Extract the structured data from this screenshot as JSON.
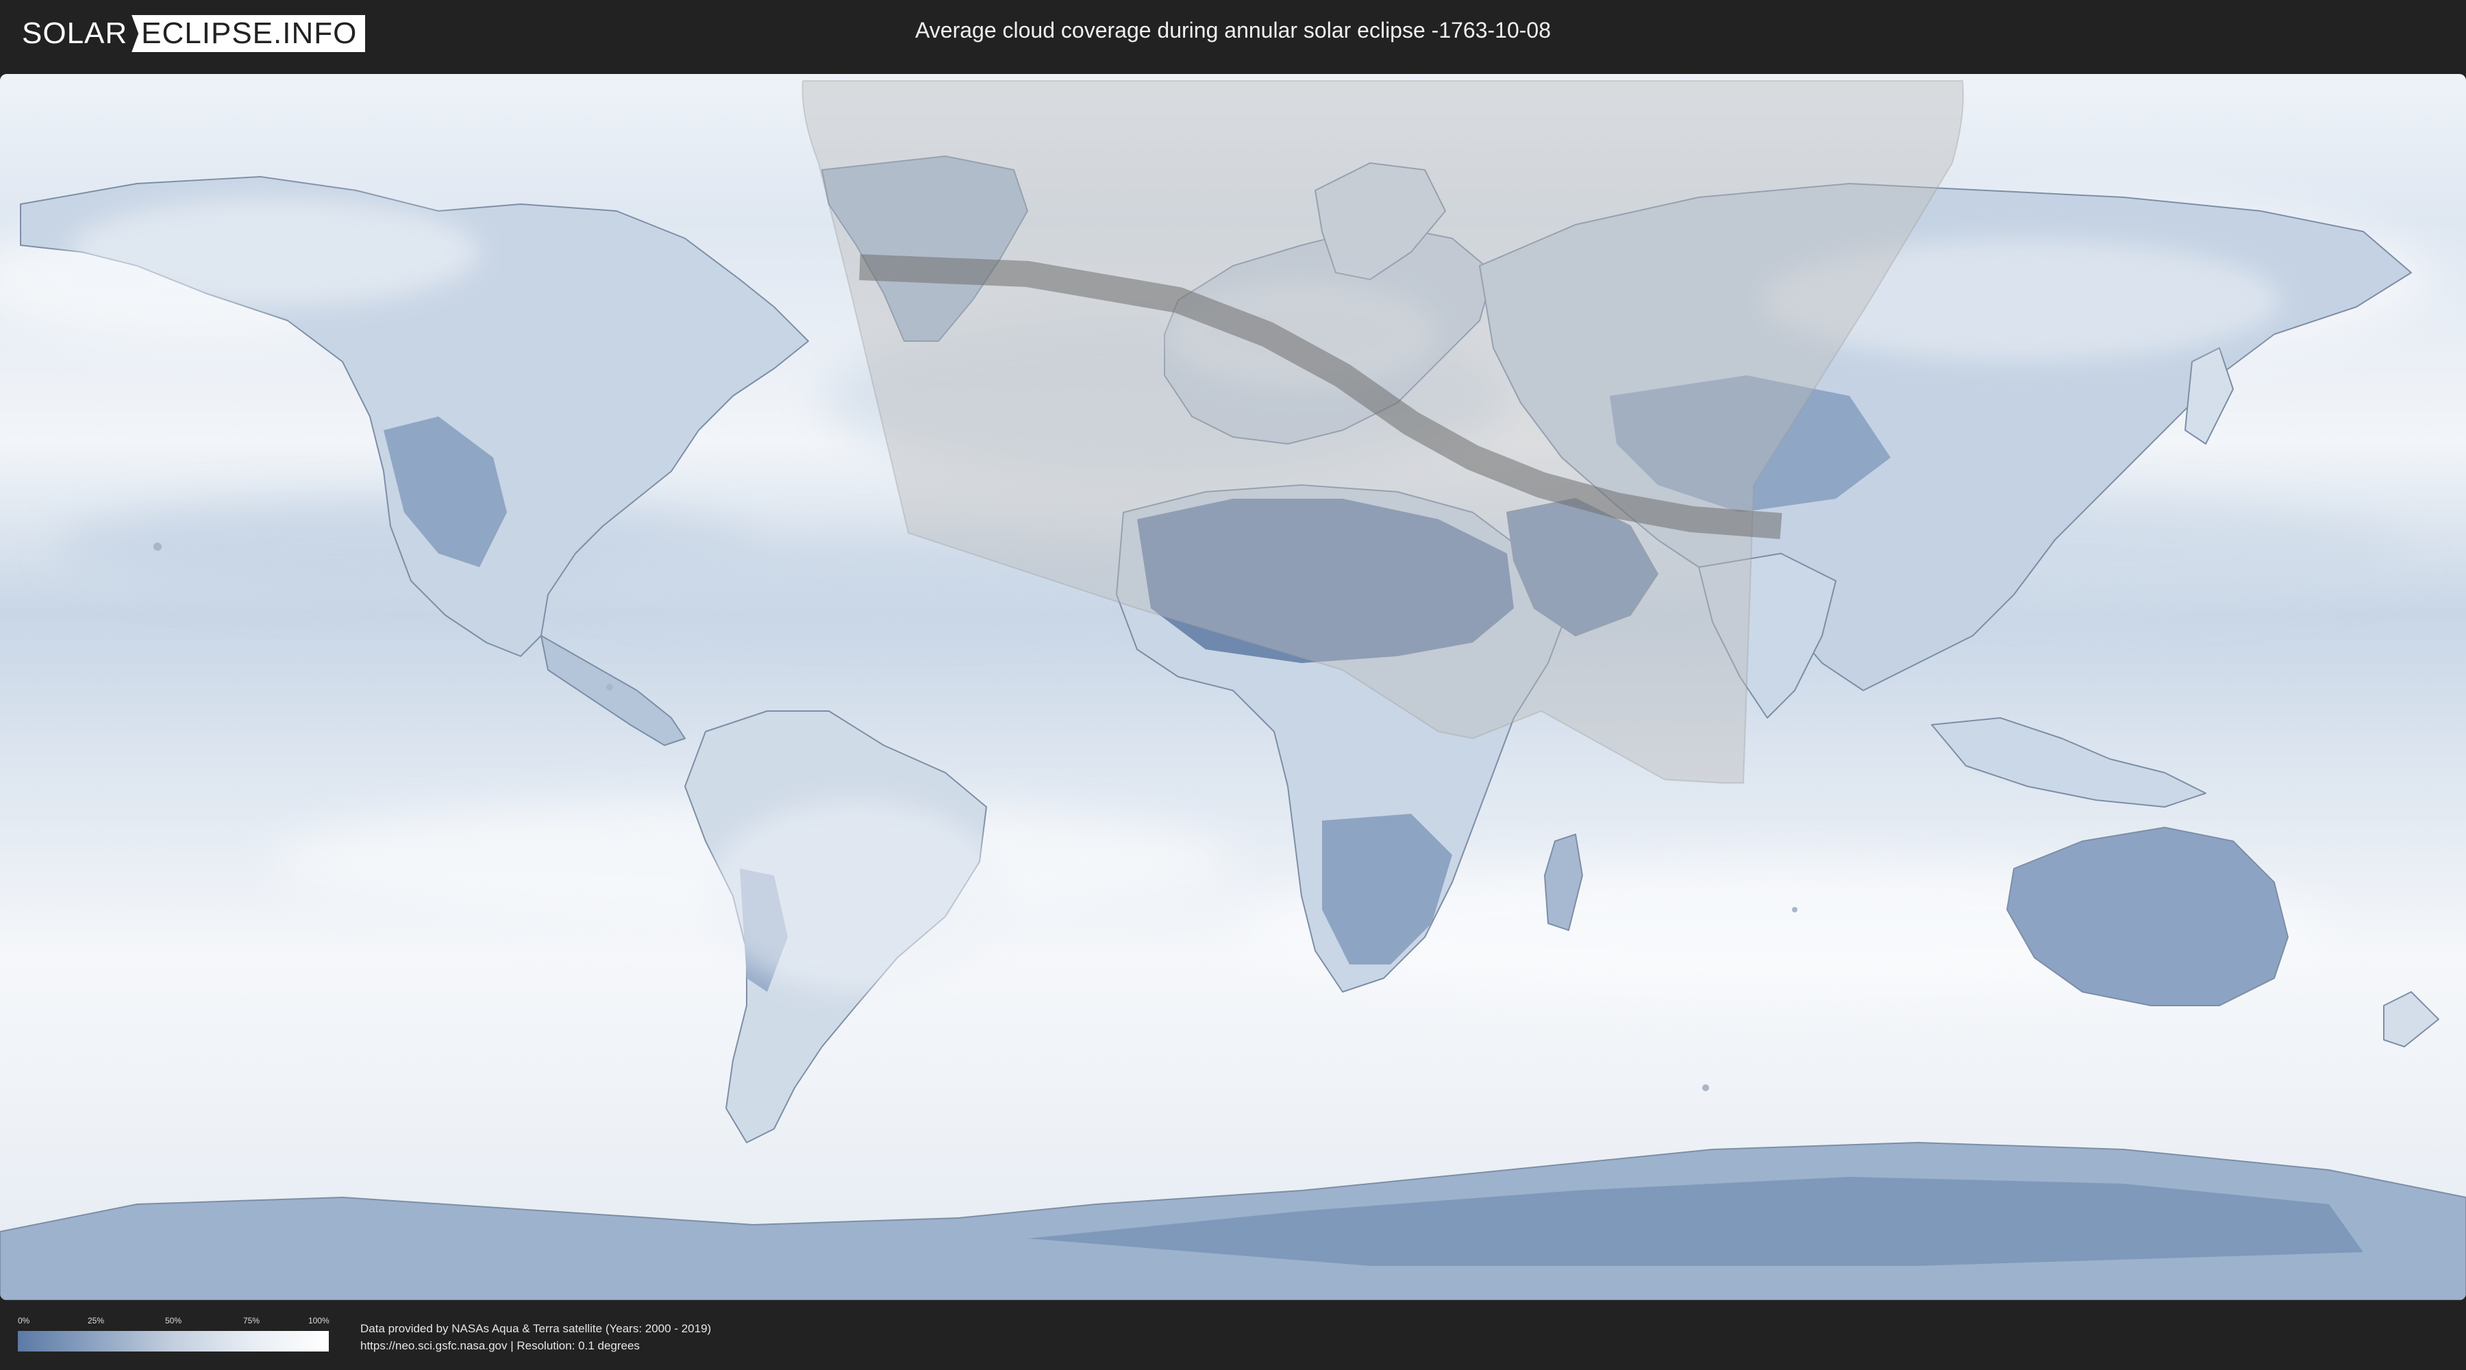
{
  "header": {
    "logo_left": "SOLAR",
    "logo_right": "ECLIPSE.INFO",
    "title": "Average cloud coverage during annular solar eclipse -1763-10-08"
  },
  "map": {
    "type": "equirectangular world cloud-coverage map",
    "colors": {
      "clear": "#5b7aa5",
      "cloudy": "#ffffff",
      "visibility_zone": "#bfbfbf",
      "annular_path": "#6f6f6f",
      "coastline": "#7d8ea6"
    }
  },
  "legend": {
    "ticks": [
      "0%",
      "25%",
      "50%",
      "75%",
      "100%"
    ]
  },
  "footer": {
    "credit_line1": "Data provided by NASAs Aqua & Terra satellite (Years: 2000 - 2019)",
    "credit_line2": "https://neo.sci.gsfc.nasa.gov | Resolution: 0.1 degrees"
  }
}
